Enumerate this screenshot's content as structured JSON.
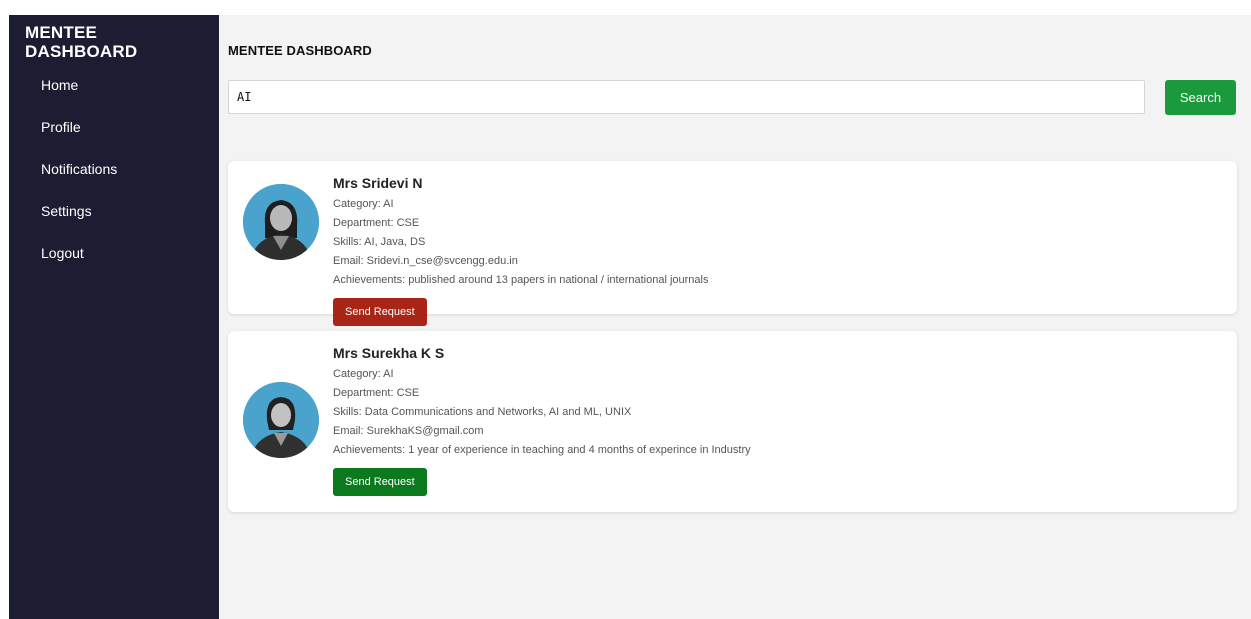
{
  "sidebar": {
    "brand": "MENTEE DASHBOARD",
    "items": [
      {
        "label": "Home"
      },
      {
        "label": "Profile"
      },
      {
        "label": "Notifications"
      },
      {
        "label": "Settings"
      },
      {
        "label": "Logout"
      }
    ]
  },
  "header": {
    "title": "MENTEE DASHBOARD"
  },
  "search": {
    "value": "AI",
    "button_label": "Search"
  },
  "mentors": [
    {
      "name": "Mrs Sridevi N",
      "category": "Category: AI",
      "department": "Department: CSE",
      "skills": "Skills: AI, Java, DS",
      "email": "Email: Sridevi.n_cse@svcengg.edu.in",
      "achievements": "Achievements: published around 13 papers in national / international journals",
      "button_label": "Send Request",
      "button_color": "#a92617"
    },
    {
      "name": "Mrs Surekha K S",
      "category": "Category: AI",
      "department": "Department: CSE",
      "skills": "Skills: Data Communications and Networks, AI and ML, UNIX",
      "email": "Email: SurekhaKS@gmail.com",
      "achievements": "Achievements: 1 year of experience in teaching and 4 months of experince in Industry",
      "button_label": "Send Request",
      "button_color": "#0b7a1e"
    }
  ],
  "colors": {
    "sidebar_bg": "#1c1d33",
    "main_bg": "#f3f3f4",
    "search_button": "#1a9a3c",
    "avatar_ring": "#4aa3cc"
  }
}
